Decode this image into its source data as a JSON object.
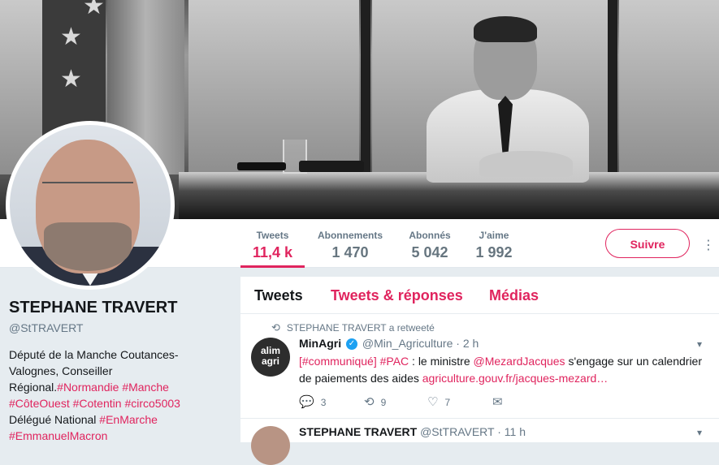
{
  "profile": {
    "name": "STEPHANE TRAVERT",
    "handle": "@StTRAVERT",
    "bio": {
      "line1": "Député de la Manche Coutances-Valognes, Conseiller Régional.",
      "tag_normandie": "#Normandie",
      "tag_manche": "#Manche",
      "tag_coteouest": "#CôteOuest",
      "tag_cotentin": "#Cotentin",
      "tag_circo": "#circo5003",
      "line2": "Délégué National",
      "tag_enmarche": "#EnMarche",
      "tag_macron": "#EmmanuelMacron"
    }
  },
  "stats": [
    {
      "label": "Tweets",
      "value": "11,4 k"
    },
    {
      "label": "Abonnements",
      "value": "1 470"
    },
    {
      "label": "Abonnés",
      "value": "5 042"
    },
    {
      "label": "J'aime",
      "value": "1 992"
    }
  ],
  "follow_label": "Suivre",
  "more_icon": "more-vertical-icon",
  "tabs": [
    "Tweets",
    "Tweets & réponses",
    "Médias"
  ],
  "tweets": [
    {
      "retweet_note": "STEPHANE TRAVERT a retweeté",
      "avatar_text_1": "alim",
      "avatar_text_2": "agri",
      "author": "MinAgri",
      "handle": "@Min_Agriculture",
      "time": "2 h",
      "text_tag1": "[#communiqué]",
      "text_tag2": "#PAC",
      "text_part1": " : le ministre ",
      "text_mention": "@MezardJacques",
      "text_part2": " s'engage sur un calendrier de paiements des aides ",
      "text_link": "agriculture.gouv.fr/jacques-mezard…",
      "replies": "3",
      "retweets": "9",
      "likes": "7"
    },
    {
      "author": "STEPHANE TRAVERT",
      "handle": "@StTRAVERT",
      "time": "11 h"
    }
  ],
  "colors": {
    "accent": "#e0245e",
    "muted": "#657786",
    "background": "#e6ecf0",
    "verified": "#1da1f2"
  }
}
